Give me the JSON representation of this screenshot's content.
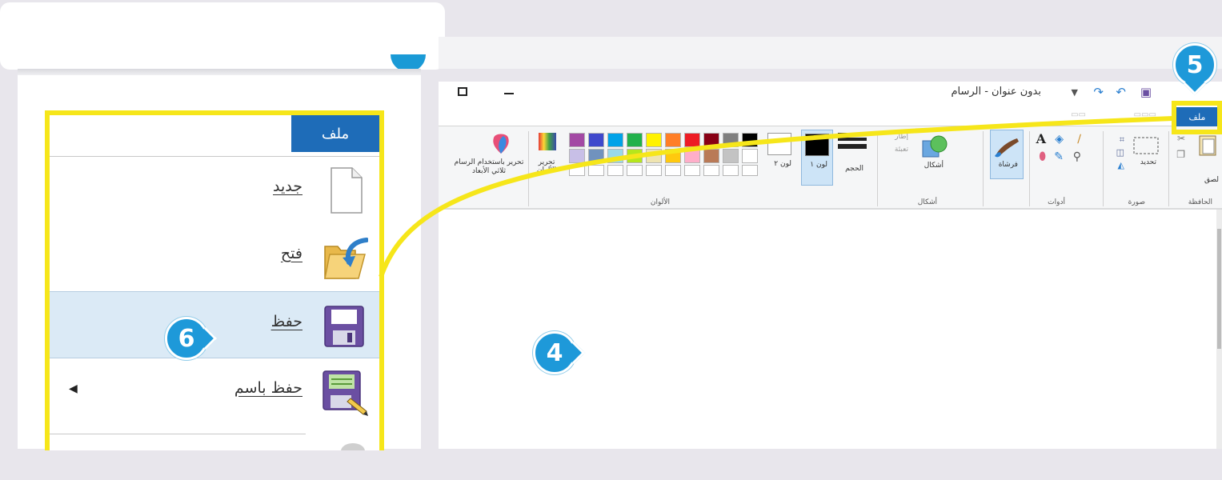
{
  "file_menu": {
    "tab_label": "ملف",
    "items": [
      {
        "label": "جديد",
        "icon": "new-document-icon"
      },
      {
        "label": "فتح",
        "icon": "open-folder-icon"
      },
      {
        "label": "حفظ",
        "icon": "save-floppy-icon",
        "highlighted": true
      },
      {
        "label": "حفظ باسم",
        "icon": "save-as-icon",
        "has_submenu": true
      }
    ]
  },
  "paint_window": {
    "title": "بدون عنوان - الرسام",
    "file_tab_label": "ملف",
    "ribbon": {
      "groups": {
        "clipboard": "الحافظة",
        "image": "صورة",
        "tools": "أدوات",
        "shapes": "أشكال",
        "colors": "الألوان"
      },
      "buttons": {
        "paste": "لصق",
        "select": "تحديد",
        "brushes": "فرشاة",
        "shapes": "أشكال",
        "size": "الحجم",
        "color1": "لون ١",
        "color2": "لون ٢",
        "edit_colors": "تحرير الألوان",
        "paint3d": "تحرير باستخدام الرسام ثلاثي الأبعاد",
        "outline": "إطار",
        "fill": "تعبئة"
      }
    }
  },
  "palette": {
    "row1": [
      "#000000",
      "#7f7f7f",
      "#880015",
      "#ed1c24",
      "#ff7f27",
      "#fff200",
      "#22b14c",
      "#00a2e8",
      "#3f48cc",
      "#a349a4"
    ],
    "row2": [
      "#ffffff",
      "#c3c3c3",
      "#b97a57",
      "#ffaec9",
      "#ffc90e",
      "#efe4b0",
      "#b5e61d",
      "#99d9ea",
      "#7092be",
      "#c8bfe7"
    ],
    "highlight_color": "#f6e61a",
    "accent": "#1e6cb8"
  },
  "callouts": {
    "c4": "4",
    "c5": "5",
    "c6": "6"
  }
}
